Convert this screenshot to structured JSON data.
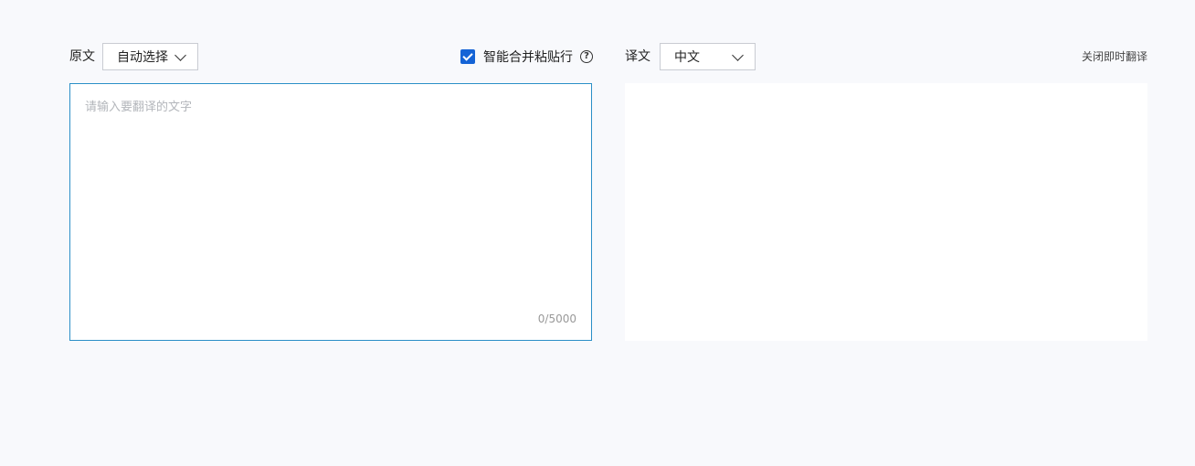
{
  "source": {
    "label": "原文",
    "language": "自动选择",
    "placeholder": "请输入要翻译的文字",
    "counter": "0/5000"
  },
  "merge_paste": {
    "label": "智能合并粘贴行",
    "checked": true,
    "help_glyph": "?"
  },
  "target": {
    "label": "译文",
    "language": "中文",
    "text": ""
  },
  "instant_translate": {
    "label": "关闭即时翻译"
  },
  "colors": {
    "accent": "#1463d6",
    "focus_border": "#2b8fc7",
    "background": "#f8f9fc"
  }
}
